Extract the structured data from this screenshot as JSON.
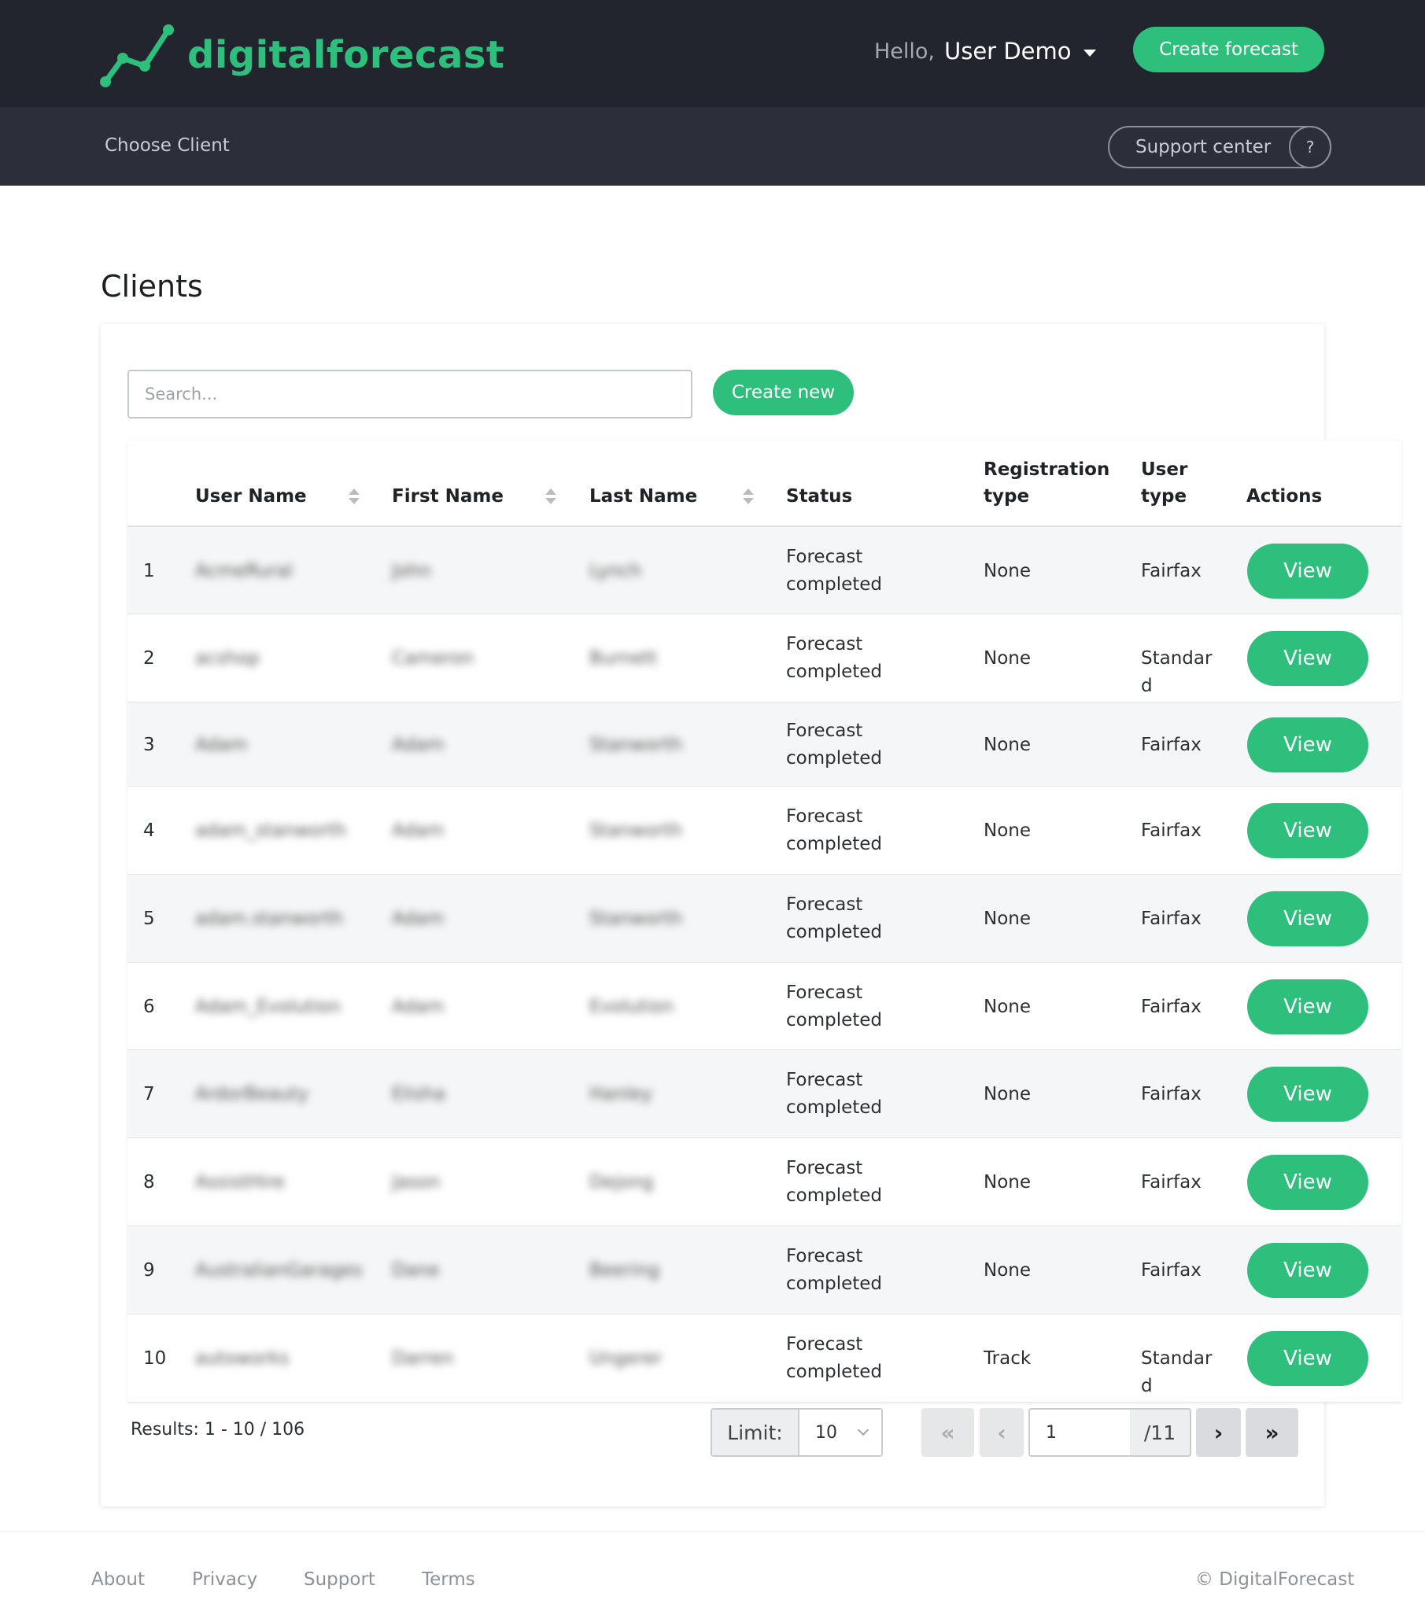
{
  "header": {
    "brand": "digitalforecast",
    "greeting": "Hello,",
    "user_name": "User Demo",
    "create_forecast_label": "Create forecast"
  },
  "subnav": {
    "choose_client_label": "Choose Client",
    "support_label": "Support center",
    "help_glyph": "?"
  },
  "page": {
    "title": "Clients",
    "search_placeholder": "Search...",
    "create_new_label": "Create new"
  },
  "table": {
    "columns": [
      "User Name",
      "First Name",
      "Last Name",
      "Status",
      "Registration type",
      "User type",
      "Actions"
    ],
    "sortable_columns": [
      "User Name",
      "First Name",
      "Last Name"
    ],
    "view_label": "View",
    "rows": [
      {
        "n": "1",
        "username": "AcmeRural",
        "first": "John",
        "last": "Lynch",
        "status": "Forecast completed",
        "reg": "None",
        "utype": "Fairfax"
      },
      {
        "n": "2",
        "username": "acshop",
        "first": "Cameron",
        "last": "Burnett",
        "status": "Forecast completed",
        "reg": "None",
        "utype": "Standard"
      },
      {
        "n": "3",
        "username": "Adam",
        "first": "Adam",
        "last": "Stanworth",
        "status": "Forecast completed",
        "reg": "None",
        "utype": "Fairfax"
      },
      {
        "n": "4",
        "username": "adam_stanworth",
        "first": "Adam",
        "last": "Stanworth",
        "status": "Forecast completed",
        "reg": "None",
        "utype": "Fairfax"
      },
      {
        "n": "5",
        "username": "adam.stanworth",
        "first": "Adam",
        "last": "Stanworth",
        "status": "Forecast completed",
        "reg": "None",
        "utype": "Fairfax"
      },
      {
        "n": "6",
        "username": "Adam_Evolution",
        "first": "Adam",
        "last": "Evolution",
        "status": "Forecast completed",
        "reg": "None",
        "utype": "Fairfax"
      },
      {
        "n": "7",
        "username": "ArdorBeauty",
        "first": "Elisha",
        "last": "Hanley",
        "status": "Forecast completed",
        "reg": "None",
        "utype": "Fairfax"
      },
      {
        "n": "8",
        "username": "AssistHire",
        "first": "Jason",
        "last": "Dejong",
        "status": "Forecast completed",
        "reg": "None",
        "utype": "Fairfax"
      },
      {
        "n": "9",
        "username": "AustralianGarages",
        "first": "Dane",
        "last": "Beering",
        "status": "Forecast completed",
        "reg": "None",
        "utype": "Fairfax"
      },
      {
        "n": "10",
        "username": "autoworks",
        "first": "Darren",
        "last": "Ungerer",
        "status": "Forecast completed",
        "reg": "Track",
        "utype": "Standard"
      }
    ]
  },
  "pagination": {
    "results_text": "Results: 1 - 10 / 106",
    "limit_label": "Limit:",
    "limit_value": "10",
    "current_page": "1",
    "total_pages_text": "/11",
    "first_glyph": "«",
    "prev_glyph": "‹",
    "next_glyph": "›",
    "last_glyph": "»"
  },
  "footer": {
    "links": [
      "About",
      "Privacy",
      "Support",
      "Terms"
    ],
    "copyright": "© DigitalForecast"
  },
  "colors": {
    "accent": "#2fbf7d",
    "topbar": "#22242e",
    "subbar": "#2c2e3a"
  },
  "icons": [
    "logo-trend-icon",
    "caret-down-icon",
    "help-icon",
    "sort-icon",
    "chevron-down-icon",
    "first-page-icon",
    "prev-page-icon",
    "next-page-icon",
    "last-page-icon"
  ]
}
